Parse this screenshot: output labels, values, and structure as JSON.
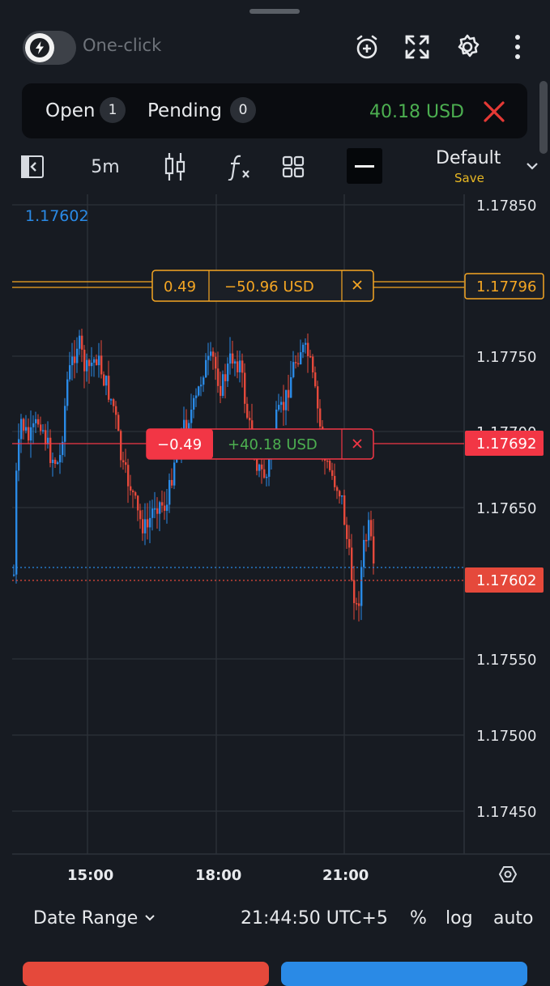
{
  "top_bar": {
    "one_click_label": "One-click",
    "icons": [
      "lightning-icon",
      "add-alert-icon",
      "fullscreen-icon",
      "gear-icon",
      "more-vert-icon"
    ]
  },
  "positions": {
    "open_label": "Open",
    "open_count": "1",
    "pending_label": "Pending",
    "pending_count": "0",
    "total_profit": "40.18 USD",
    "colors": {
      "profit": "#4caf50",
      "close": "#e53935"
    }
  },
  "toolbar": {
    "timeframe": "5m",
    "layout_name": "Default",
    "layout_save": "Save",
    "icons": [
      "panel-toggle-icon",
      "candles-icon",
      "indicators-icon",
      "grid-icon",
      "line-tool-icon",
      "chevron-down-icon"
    ]
  },
  "chart": {
    "current_price_left": "1.17602",
    "price_ticks": [
      "1.17850",
      "1.17750",
      "1.17650",
      "1.17550",
      "1.17500",
      "1.17450"
    ],
    "partial_tick": "1.17700",
    "time_ticks": [
      "15:00",
      "18:00",
      "21:00"
    ],
    "order_tp": {
      "volume": "0.49",
      "pnl": "−50.96 USD",
      "price": "1.17796",
      "color": "#f5a623"
    },
    "order_open": {
      "volume": "−0.49",
      "pnl": "+40.18 USD",
      "price": "1.17692",
      "color": "#f23645"
    },
    "current_price_tag": "1.17602",
    "colors": {
      "up": "#2a8ae6",
      "down": "#e5493b"
    }
  },
  "bottom_bar": {
    "date_range": "Date Range",
    "time": "21:44:50 UTC+5",
    "percent": "%",
    "log": "log",
    "auto": "auto"
  }
}
